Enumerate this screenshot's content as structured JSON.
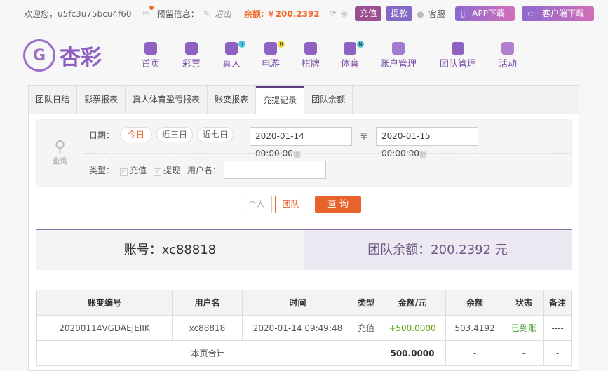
{
  "topbar": {
    "welcome": "欢迎您，u5fc3u75bcu4f60",
    "reserved_label": "预留信息：",
    "logout": "退出",
    "balance": "余额: ￥200.2392",
    "deposit": "充值",
    "withdraw": "提款",
    "service": "客服",
    "app_download": "APP下载",
    "client_download": "客户端下载"
  },
  "logo": {
    "text": "杏彩"
  },
  "nav": [
    {
      "label": "首页",
      "icon": "home-icon"
    },
    {
      "label": "彩票",
      "icon": "ticket-icon"
    },
    {
      "label": "真人",
      "icon": "dealer-icon",
      "badge": "N"
    },
    {
      "label": "电游",
      "icon": "gamepad-icon",
      "badge": "H"
    },
    {
      "label": "棋牌",
      "icon": "cards-icon"
    },
    {
      "label": "体育",
      "icon": "trophy-icon",
      "badge": "N"
    },
    {
      "label": "账户管理",
      "icon": "yen-icon"
    },
    {
      "label": "团队管理",
      "icon": "team-icon"
    },
    {
      "label": "活动",
      "icon": "gift-icon"
    }
  ],
  "tabs": [
    "团队日结",
    "彩票报表",
    "真人体育盈亏报表",
    "账变报表",
    "充提记录",
    "团队余额"
  ],
  "filter": {
    "search_label": "查询",
    "date_label": "日期：",
    "today": "今日",
    "three_days": "近三日",
    "seven_days": "近七日",
    "start": "2020-01-14 00:00:00",
    "to": "至",
    "end": "2020-01-15 00:00:00",
    "type_label": "类型：",
    "deposit": "充值",
    "withdraw": "提现",
    "username_label": "用户名：",
    "username_value": ""
  },
  "actions": {
    "personal": "个人",
    "team": "团队",
    "query": "查 询"
  },
  "summary": {
    "account": "账号：xc88818",
    "team_balance": "团队余额：200.2392 元"
  },
  "table": {
    "headers": [
      "账变编号",
      "用户名",
      "时间",
      "类型",
      "金额/元",
      "余额",
      "状态",
      "备注"
    ],
    "rows": [
      [
        "20200114VGDAEJEIIK",
        "xc88818",
        "2020-01-14 09:49:48",
        "充值",
        "+500.0000",
        "503.4192",
        "已到账",
        "----"
      ]
    ],
    "total": {
      "label": "本页合计",
      "amount": "500.0000",
      "balance": "-",
      "status": "-",
      "note": "-"
    }
  },
  "colors": {
    "accent": "#e8632b",
    "purple": "#7b4fa4",
    "green": "#5aa316"
  }
}
